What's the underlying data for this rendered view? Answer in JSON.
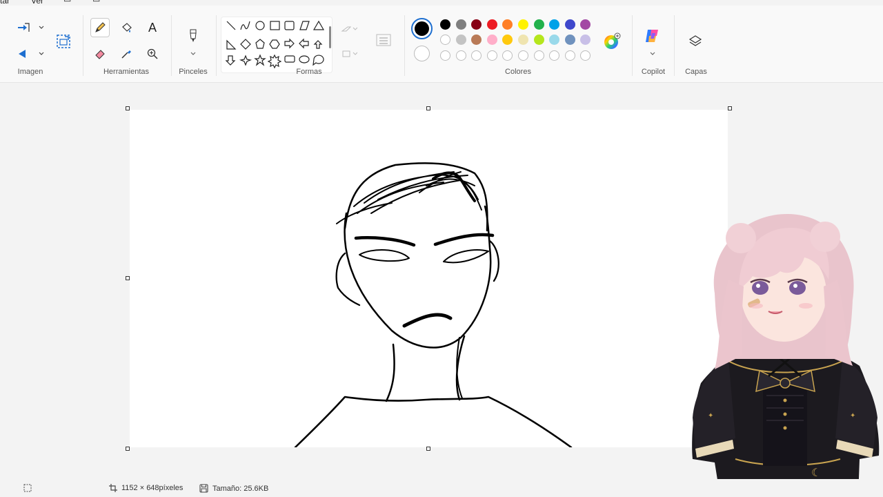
{
  "menu": {
    "item_file_partial": "tar",
    "item_view": "Ver"
  },
  "groups": {
    "imagen": "Imagen",
    "herramientas": "Herramientas",
    "pinceles": "Pinceles",
    "formas": "Formas",
    "colores": "Colores",
    "copilot": "Copilot",
    "capas": "Capas"
  },
  "tools": [
    "pencil-icon",
    "fill-icon",
    "text-icon",
    "eraser-icon",
    "color-picker-icon",
    "magnifier-icon"
  ],
  "palette": {
    "primary": "#000000",
    "secondary": "#ffffff",
    "row1": [
      "#000000",
      "#7f7f7f",
      "#880015",
      "#ed1c24",
      "#ff7f27",
      "#fff200",
      "#22b14c",
      "#00a2e8",
      "#3f48cc",
      "#a349a4"
    ],
    "row2": [
      "#ffffff",
      "#c3c3c3",
      "#b97a57",
      "#ffaec9",
      "#ffc90e",
      "#efe4b0",
      "#b5e61d",
      "#99d9ea",
      "#7092be",
      "#c8bfe7"
    ],
    "row3_count": 10
  },
  "status": {
    "dimensions": "1152 × 648píxeles",
    "size": "Tamaño: 25.6KB"
  }
}
